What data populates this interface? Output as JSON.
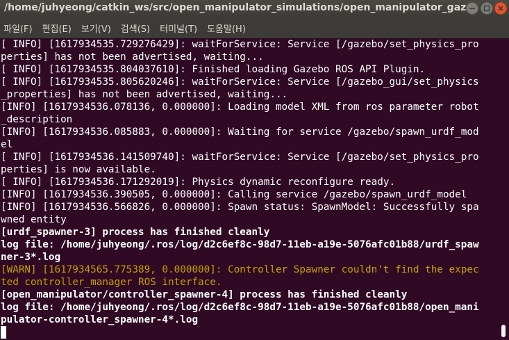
{
  "window": {
    "title": "/home/juhyeong/catkin_ws/src/open_manipulator_simulations/open_manipulator_gazebo/l..."
  },
  "menu": {
    "items": [
      "파일(F)",
      "편집(E)",
      "보기(V)",
      "검색(S)",
      "터미널(T)",
      "도움말(H)"
    ]
  },
  "terminal": {
    "lines": [
      "[ INFO] [1617934535.729276429]: waitForService: Service [/gazebo/set_physics_pro",
      "perties] has not been advertised, waiting...",
      "[ INFO] [1617934535.804037610]: Finished loading Gazebo ROS API Plugin.",
      "[ INFO] [1617934535.805620246]: waitForService: Service [/gazebo_gui/set_physics",
      "_properties] has not been advertised, waiting...",
      "[INFO] [1617934536.078136, 0.000000]: Loading model XML from ros parameter robot",
      "_description",
      "[INFO] [1617934536.085883, 0.000000]: Waiting for service /gazebo/spawn_urdf_mod",
      "el",
      "[ INFO] [1617934536.141509740]: waitForService: Service [/gazebo/set_physics_pro",
      "perties] is now available.",
      "[ INFO] [1617934536.171292019]: Physics dynamic reconfigure ready.",
      "[INFO] [1617934536.390505, 0.000000]: Calling service /gazebo/spawn_urdf_model",
      "[INFO] [1617934536.566826, 0.000000]: Spawn status: SpawnModel: Successfully spa",
      "wned entity",
      "[urdf_spawner-3] process has finished cleanly",
      "log file: /home/juhyeong/.ros/log/d2c6ef8c-98d7-11eb-a19e-5076afc01b88/urdf_spaw",
      "ner-3*.log",
      "[WARN] [1617934565.775389, 0.000000]: Controller Spawner couldn't find the expec",
      "ted controller_manager ROS interface.",
      "[open_manipulator/controller_spawner-4] process has finished cleanly",
      "log file: /home/juhyeong/.ros/log/d2c6ef8c-98d7-11eb-a19e-5076afc01b88/open_mani",
      "pulator-controller_spawner-4*.log"
    ]
  },
  "colors": {
    "terminal_bg": "#300a24",
    "text": "#ffffff",
    "warn": "#c4a000",
    "close_button": "#e7532d"
  },
  "icons": {
    "minimize": "minimize-icon",
    "maximize": "maximize-icon",
    "close": "close-icon"
  }
}
